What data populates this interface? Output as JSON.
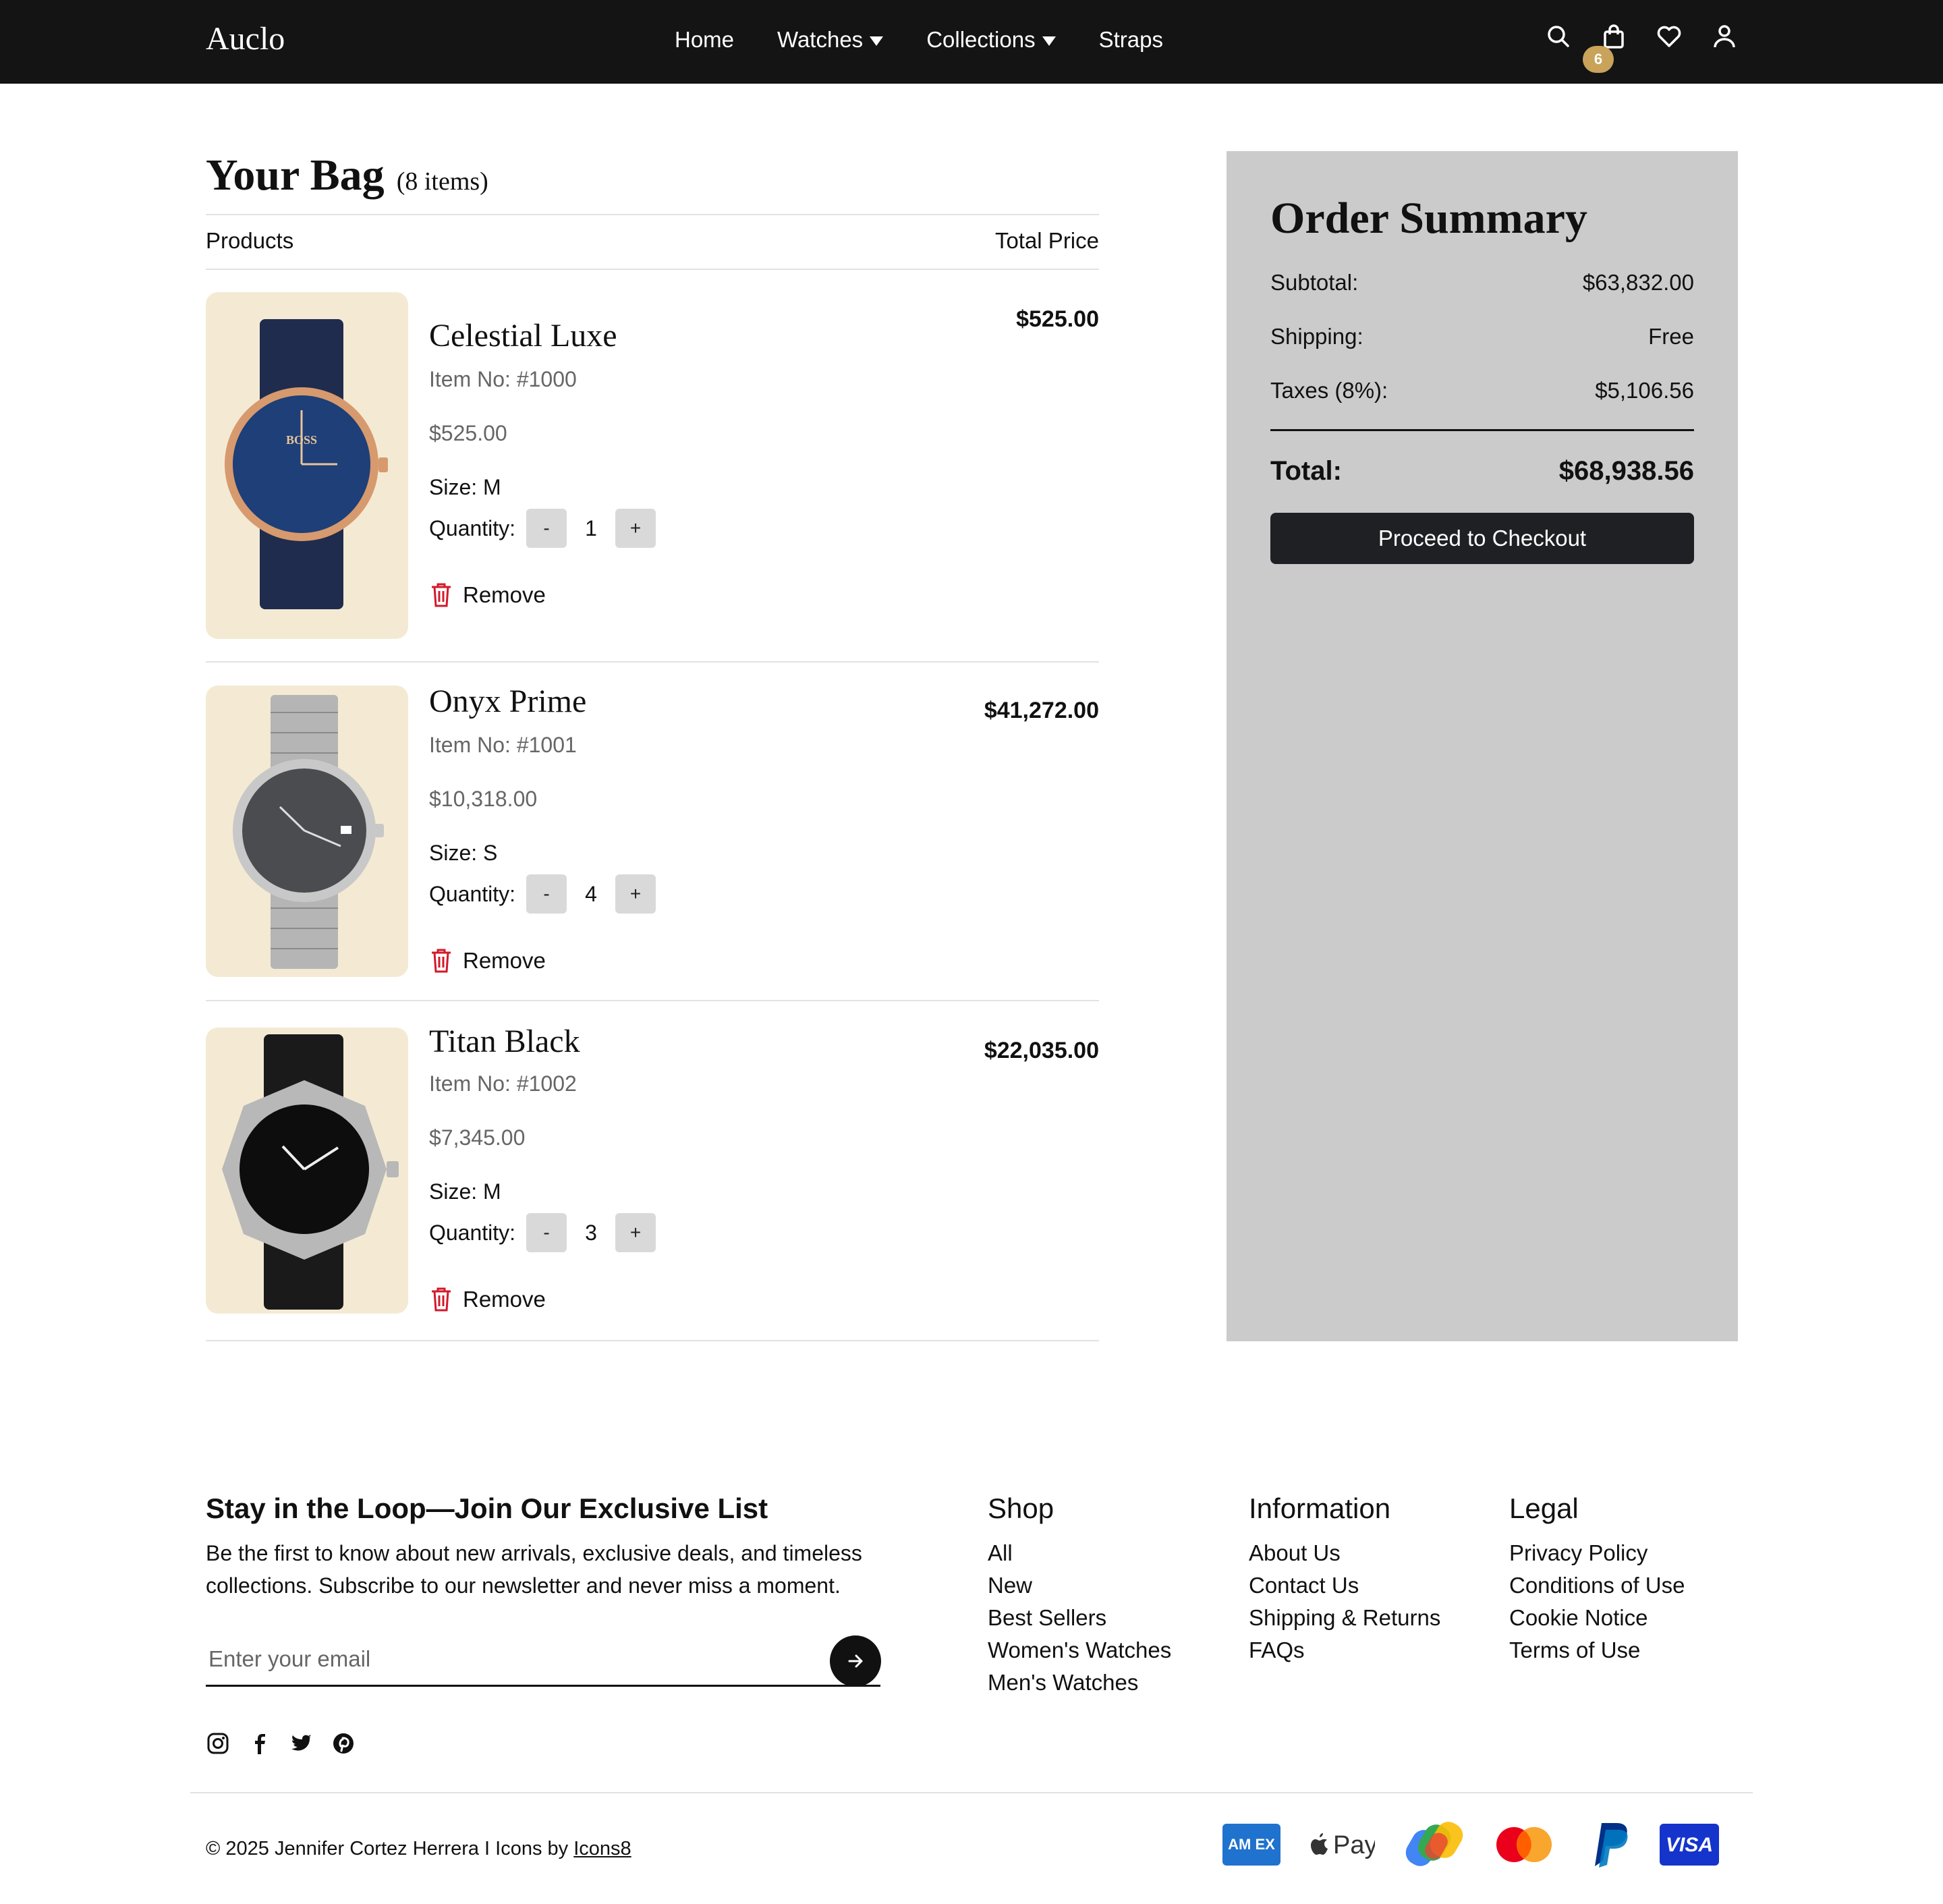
{
  "header": {
    "logo": "Auclo",
    "nav": [
      {
        "label": "Home"
      },
      {
        "label": "Watches"
      },
      {
        "label": "Collections"
      },
      {
        "label": "Straps"
      }
    ],
    "cart_count": "6"
  },
  "bag": {
    "title": "Your Bag",
    "count_label": "(8 items)",
    "col_products": "Products",
    "col_total": "Total Price",
    "items": [
      {
        "name": "Celestial Luxe",
        "item_no": "Item No: #1000",
        "price": "$525.00",
        "size": "Size: M",
        "quantity_label": "Quantity:",
        "quantity": "1",
        "total": "$525.00",
        "remove": "Remove",
        "dial_color": "#1e3f78",
        "case_color": "#d69a6e",
        "strap_color": "#1f2c4e"
      },
      {
        "name": "Onyx Prime",
        "item_no": "Item No: #1001",
        "price": "$10,318.00",
        "size": "Size: S",
        "quantity_label": "Quantity:",
        "quantity": "4",
        "total": "$41,272.00",
        "remove": "Remove",
        "dial_color": "#4a4c50",
        "case_color": "#c8c8c8",
        "strap_color": "#b5b5b5"
      },
      {
        "name": "Titan Black",
        "item_no": "Item No: #1002",
        "price": "$7,345.00",
        "size": "Size: M",
        "quantity_label": "Quantity:",
        "quantity": "3",
        "total": "$22,035.00",
        "remove": "Remove",
        "dial_color": "#0d0d0d",
        "case_color": "#b8b8b8",
        "strap_color": "#1a1a1a"
      }
    ]
  },
  "summary": {
    "title": "Order Summary",
    "subtotal_label": "Subtotal:",
    "subtotal": "$63,832.00",
    "shipping_label": "Shipping:",
    "shipping": "Free",
    "taxes_label": "Taxes (8%):",
    "taxes": "$5,106.56",
    "total_label": "Total:",
    "total": "$68,938.56",
    "checkout": "Proceed to Checkout"
  },
  "footer": {
    "newsletter_title": "Stay in the Loop—Join Our Exclusive List",
    "newsletter_desc": "Be the first to know about new arrivals, exclusive deals, and timeless collections. Subscribe to our newsletter and never miss a moment.",
    "email_placeholder": "Enter your email",
    "shop": {
      "title": "Shop",
      "links": [
        "All",
        "New",
        "Best Sellers",
        "Women's Watches",
        "Men's Watches"
      ]
    },
    "information": {
      "title": "Information",
      "links": [
        "About Us",
        "Contact Us",
        "Shipping & Returns",
        "FAQs"
      ]
    },
    "legal": {
      "title": "Legal",
      "links": [
        "Privacy Policy",
        "Conditions of Use",
        "Cookie Notice",
        "Terms of Use"
      ]
    },
    "copyright": "© 2025 Jennifer Cortez Herrera I Icons by ",
    "icons_credit": "Icons8",
    "payments": {
      "amex": "AM EX",
      "applepay": "Pay",
      "visa": "VISA"
    }
  }
}
